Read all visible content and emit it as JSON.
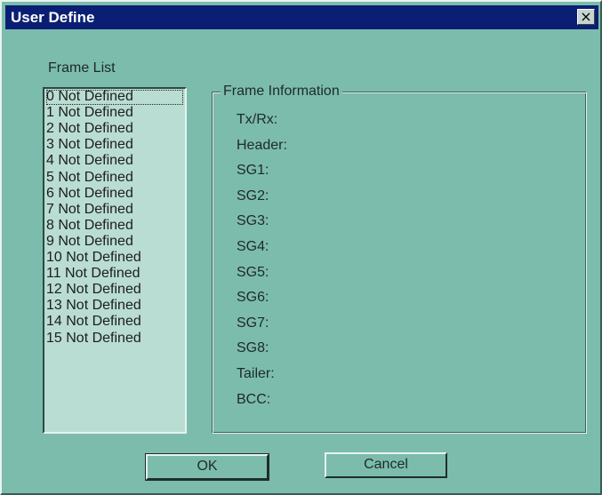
{
  "window": {
    "title": "User Define",
    "close_glyph": "×"
  },
  "frame_list": {
    "label": "Frame List",
    "items": [
      "0 Not Defined",
      "1 Not Defined",
      "2 Not Defined",
      "3 Not Defined",
      "4 Not Defined",
      "5 Not Defined",
      "6 Not Defined",
      "7 Not Defined",
      "8 Not Defined",
      "9 Not Defined",
      "10 Not Defined",
      "11 Not Defined",
      "12 Not Defined",
      "13 Not Defined",
      "14 Not Defined",
      "15 Not Defined"
    ],
    "selected_index": 0
  },
  "frame_info": {
    "title": "Frame Information",
    "fields": [
      "Tx/Rx:",
      "Header:",
      "SG1:",
      "SG2:",
      "SG3:",
      "SG4:",
      "SG5:",
      "SG6:",
      "SG7:",
      "SG8:",
      "Tailer:",
      "BCC:"
    ]
  },
  "buttons": {
    "ok": "OK",
    "cancel": "Cancel"
  },
  "colors": {
    "dialog_bg": "#7cbcac",
    "titlebar_bg": "#0a1f73",
    "listbox_bg": "#b9ddd2"
  }
}
